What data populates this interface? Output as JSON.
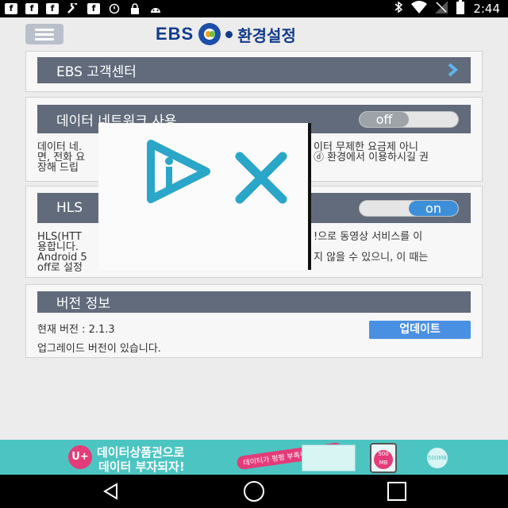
{
  "status_bar": {
    "icons": [
      "facebook-icon",
      "facebook-icon",
      "facebook-icon",
      "wrench-icon",
      "facebook-icon",
      "alarm-icon",
      "lock-icon",
      "android-icon",
      "bluetooth-icon",
      "wifi-icon",
      "signal-icon",
      "battery-icon"
    ],
    "time": "2:44"
  },
  "header": {
    "brand": "EBS",
    "title": "환경설정"
  },
  "support": {
    "label": "EBS 고객센터",
    "icon": "chevron-right-icon"
  },
  "data_network": {
    "label": "데이터 네트워크 사용",
    "toggle_label": "off",
    "desc_lines": [
      "데이터 네.",
      "면, 전화 요",
      "장해 드립"
    ],
    "desc_right": [
      "이터 무제한 요금제 아니",
      "ⓓ 환경에서 이용하시길 권"
    ]
  },
  "hls": {
    "label": "HLS",
    "toggle_label": "on",
    "desc_lines": [
      "HLS(HTT",
      "용합니다.",
      "Android 5",
      "off로 설정"
    ],
    "desc_right": [
      "!으로 동영상 서비스를 이",
      "",
      "지 않을 수 있으니, 이 때는"
    ]
  },
  "version": {
    "title": "버전 정보",
    "current": "현재 버전 : 2.1.3",
    "update_label": "업데이트",
    "notice": "업그레이드 버전이 있습니다."
  },
  "ad": {
    "logo": "U+",
    "line1": "데이터상품권으로",
    "line2": "데이터 부자되자!",
    "badge": "데이터가 펑펑 부족하시다구요?",
    "phone_text": "500 MB",
    "circle_text": "500MB"
  },
  "colors": {
    "brand": "#123b8c",
    "bar": "#616b7b",
    "accent": "#4a90e2",
    "ad_bg": "#4cc5c2"
  }
}
